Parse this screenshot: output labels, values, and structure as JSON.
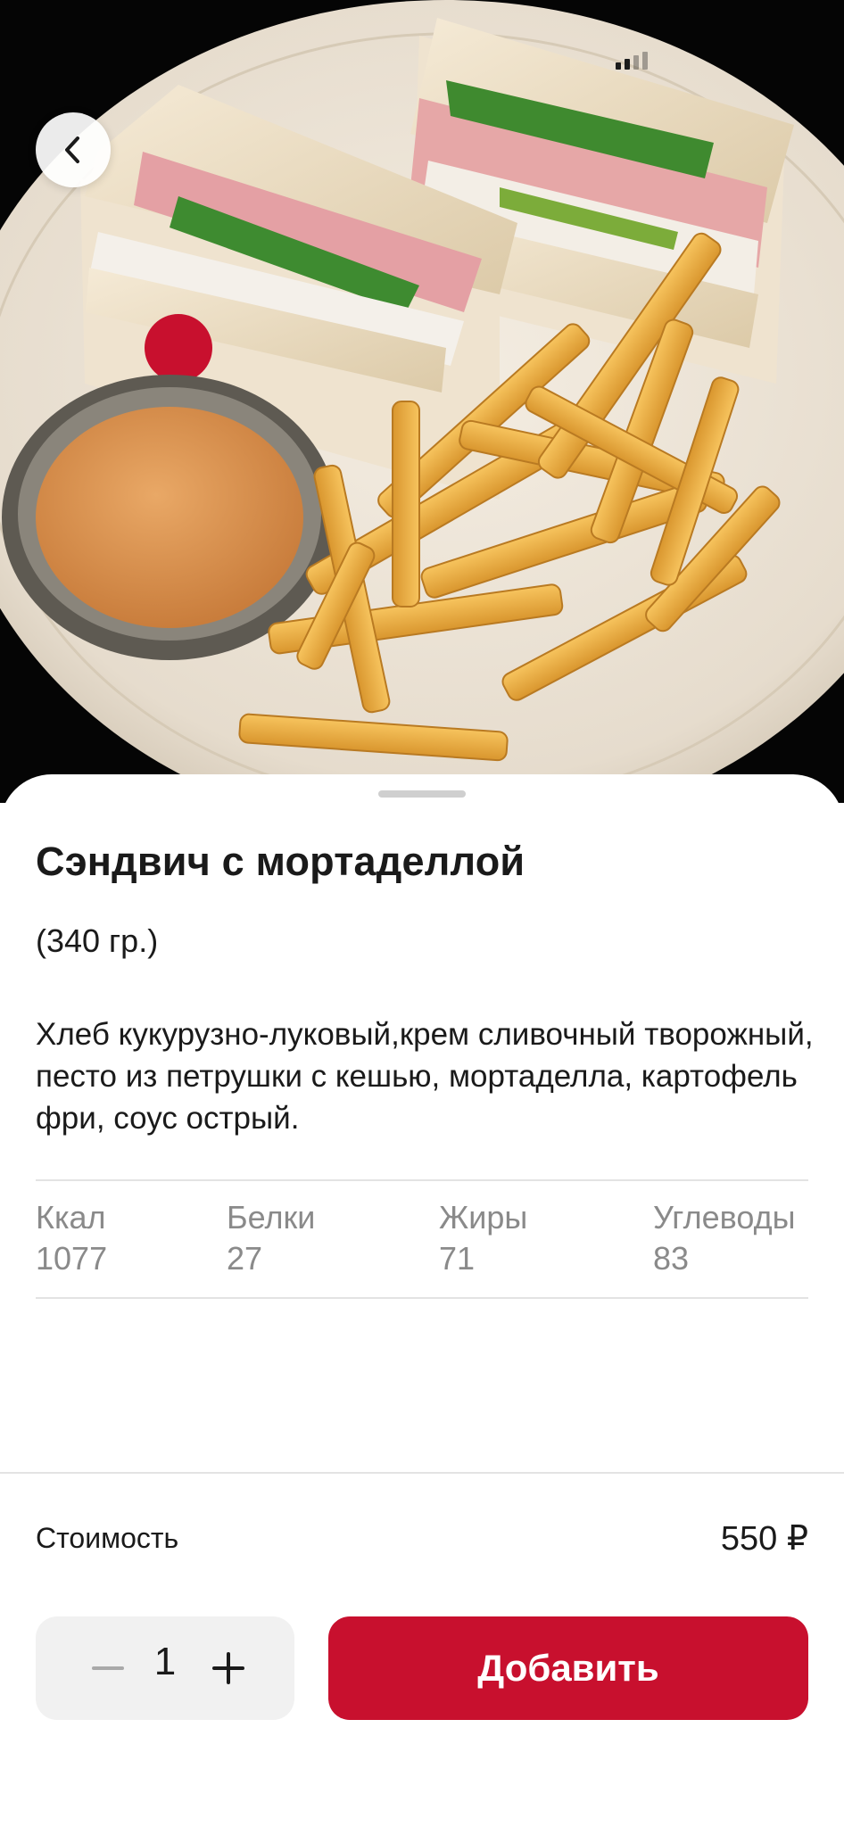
{
  "product": {
    "title": "Сэндвич с мортаделлой",
    "weight": "(340 гр.)",
    "description": "Хлеб кукурузно-луковый,крем сливочный творожный, песто из петрушки с кешью, мортаделла, картофель фри, соус острый."
  },
  "nutrition": [
    {
      "label": "Ккал",
      "value": "1077"
    },
    {
      "label": "Белки",
      "value": "27"
    },
    {
      "label": "Жиры",
      "value": "71"
    },
    {
      "label": "Углеводы",
      "value": "83"
    }
  ],
  "price": {
    "label": "Стоимость",
    "value": "550 ₽"
  },
  "cart": {
    "quantity": "1",
    "add_label": "Добавить"
  },
  "icons": {
    "back": "chevron-left-icon",
    "minus": "minus-icon",
    "plus": "plus-icon"
  },
  "colors": {
    "accent": "#c8102e",
    "secondary_text": "#8a8a8a",
    "stepper_bg": "#f1f1f1",
    "photo_bg": "#050505"
  }
}
